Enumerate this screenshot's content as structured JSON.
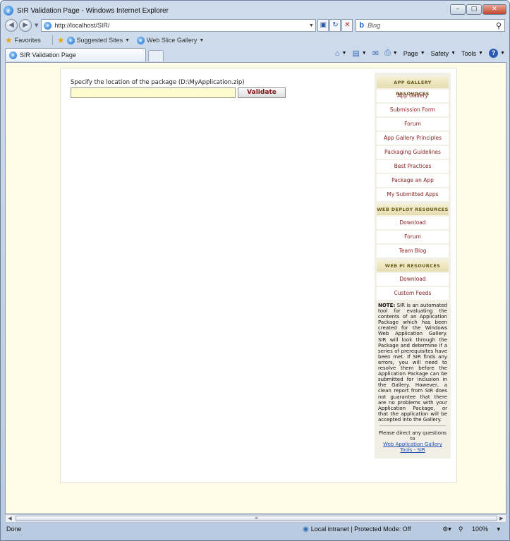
{
  "window": {
    "title": "SIR Validation Page - Windows Internet Explorer"
  },
  "address_bar": {
    "url": "http://localhost/SIR/",
    "search_placeholder": "Bing"
  },
  "favorites_bar": {
    "favorites_label": "Favorites",
    "items": [
      "Suggested Sites",
      "Web Slice Gallery"
    ]
  },
  "tabs": [
    {
      "label": "SIR Validation Page"
    }
  ],
  "command_bar": {
    "page": "Page",
    "safety": "Safety",
    "tools": "Tools"
  },
  "form": {
    "label": "Specify the location of the package (D:\\MyApplication.zip)",
    "input_value": "",
    "validate_label": "Validate"
  },
  "sidebar": {
    "sections": [
      {
        "header": "APP GALLERY RESOURCES",
        "links": [
          "App Gallery",
          "Submission Form",
          "Forum",
          "App Gallery Principles",
          "Packaging Guidelines",
          "Best Practices",
          "Package an App",
          "My Submitted Apps"
        ]
      },
      {
        "header": "WEB DEPLOY RESOURCES",
        "links": [
          "Download",
          "Forum",
          "Team Blog"
        ]
      },
      {
        "header": "WEB PI RESOURCES",
        "links": [
          "Download",
          "Custom Feeds"
        ]
      }
    ],
    "note_label": "NOTE:",
    "note_text": "SIR is an automated tool for evaluating the contents of an Application Package which has been created for the Windows Web Application Gallery. SIR will look through the Package and determine if a series of prerequisites have been met. If SIR finds any errors, you will need to resolve them before the Application Package can be submitted for inclusion in the Gallery. However, a clean report from SIR does not guarantee that there are no problems with your Application Package, or that the application will be accepted into the Gallery.",
    "contact_text": "Please direct any questions to",
    "contact_link": "Web Application Gallery Tools - SIR"
  },
  "status_bar": {
    "status": "Done",
    "zone": "Local intranet | Protected Mode: Off",
    "zoom": "100%"
  }
}
